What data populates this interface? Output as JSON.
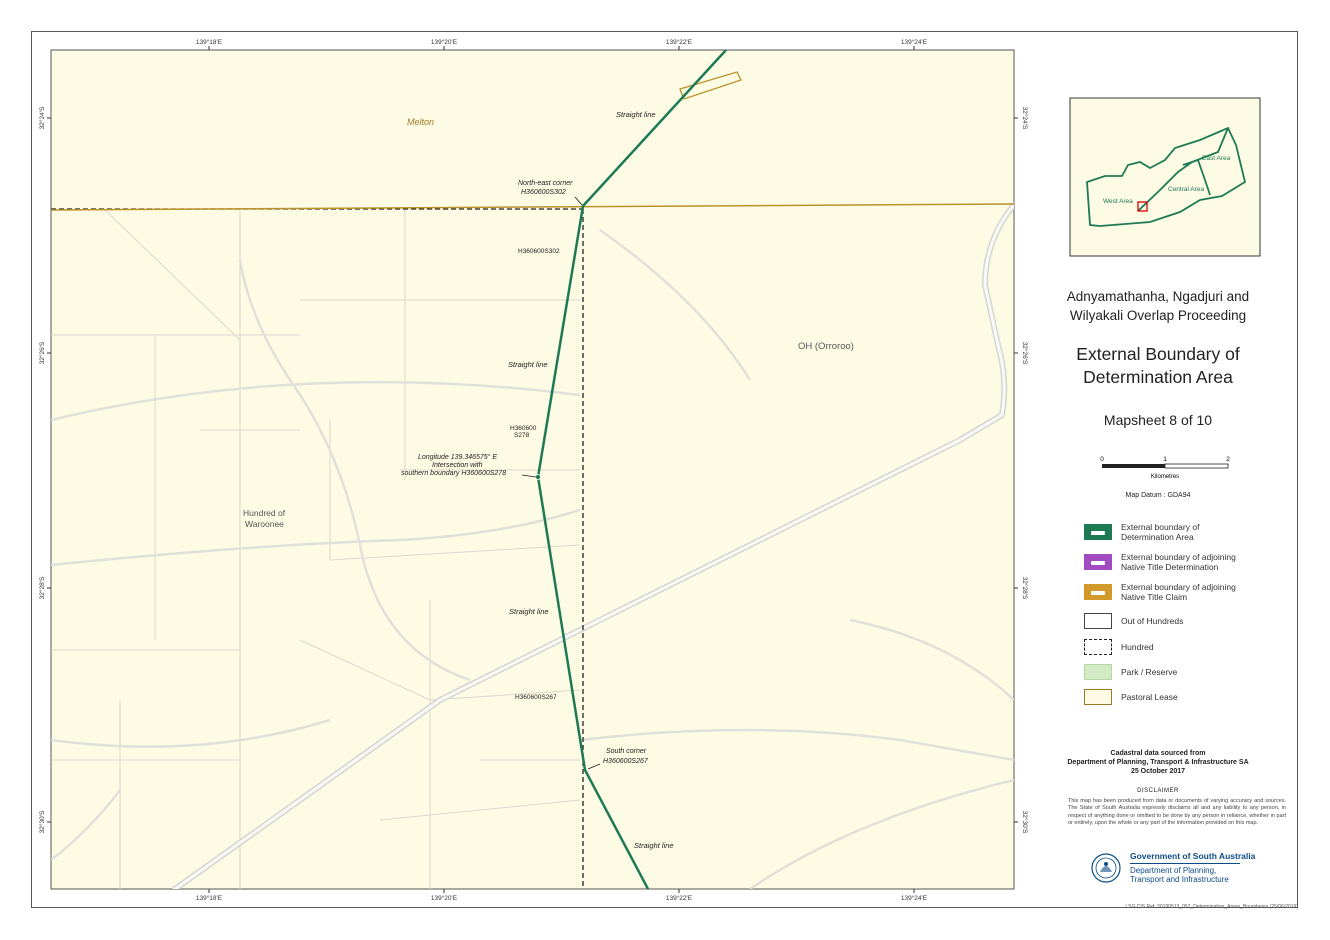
{
  "map": {
    "top_ticks": [
      "139°18'E",
      "139°20'E",
      "139°22'E",
      "139°24'E"
    ],
    "bottom_ticks": [
      "139°18'E",
      "139°20'E",
      "139°22'E",
      "139°24'E"
    ],
    "left_ticks": [
      "32°24'S",
      "32°26'S",
      "32°28'S",
      "32°30'S"
    ],
    "right_ticks": [
      "32°24'S",
      "32°26'S",
      "32°28'S",
      "32°30'S"
    ],
    "labels": {
      "melton": "Melton",
      "straight_line_1": "Straight line",
      "ne_corner_1": "North-east corner",
      "ne_corner_2": "H360600S302",
      "parcel_302": "H360600S302",
      "straight_line_2": "Straight line",
      "oh_orroroo": "OH (Orroroo)",
      "parcel_278_1": "H360600",
      "parcel_278_2": "S278",
      "longitude_1": "Longitude 139.346575° E",
      "longitude_2": "Intersection with",
      "longitude_3": "southern boundary H360600S278",
      "hundred_1": "Hundred of",
      "hundred_2": "Waroonee",
      "straight_line_3": "Straight line",
      "parcel_267": "H360600S267",
      "south_corner_1": "South corner",
      "south_corner_2": "H360600S267",
      "straight_line_4": "Straight line"
    },
    "colors": {
      "background": "#fdfbe4",
      "determination_boundary": "#1e7a55",
      "claim_boundary": "#b8922a",
      "roads": "#e6e6e2",
      "parcel_lines": "#d6d6cc"
    }
  },
  "inset": {
    "labels": {
      "east": "East Area",
      "central": "Central Area",
      "west": "West Area"
    }
  },
  "titles": {
    "proceeding_line1": "Adnyamathanha, Ngadjuri and",
    "proceeding_line2": "Wilyakali Overlap Proceeding",
    "boundary_line1": "External Boundary of",
    "boundary_line2": "Determination Area",
    "mapsheet": "Mapsheet 8 of 10"
  },
  "scale": {
    "ticks": [
      "0",
      "1",
      "2"
    ],
    "unit": "Kilometres",
    "datum": "Map Datum : GDA94"
  },
  "legend": [
    {
      "line1": "External boundary of",
      "line2": "Determination Area",
      "style": "determination",
      "color": "#1e7a55"
    },
    {
      "line1": "External boundary of adjoining",
      "line2": "Native Title Determination",
      "style": "nt-determination",
      "color": "#a24bc0"
    },
    {
      "line1": "External boundary of adjoining",
      "line2": "Native Title Claim",
      "style": "nt-claim",
      "color": "#d19a2a"
    },
    {
      "line1": "Out of Hundreds",
      "line2": "",
      "style": "out-hundreds",
      "color": "#444444"
    },
    {
      "line1": "Hundred",
      "line2": "",
      "style": "hundred",
      "color": "#222222"
    },
    {
      "line1": "Park / Reserve",
      "line2": "",
      "style": "park",
      "color": "#d4eac6"
    },
    {
      "line1": "Pastoral Lease",
      "line2": "",
      "style": "pastoral",
      "color": "#9a7a2a"
    }
  ],
  "source": {
    "line1": "Cadastral data sourced from",
    "line2": "Department of Planning, Transport & Infrastructure SA",
    "line3": "25 October 2017"
  },
  "disclaimer": {
    "heading": "DISCLAIMER",
    "body": "This map has been produced from data or documents of varying accuracy and sources. The State of South Australia expressly disclaims all and any liability to any person, in respect of anything done or omitted to be done by any person in reliance, whether in part or entirely, upon the whole or any part of the information provided on this map."
  },
  "government": {
    "name": "Government of South Australia",
    "dept_line1": "Department of Planning,",
    "dept_line2": "Transport and Infrastructure"
  },
  "footer_ref": "LSG CIS Ref: 20190513_057_Determination_Areas_Boundaries  (25/06/2019)"
}
